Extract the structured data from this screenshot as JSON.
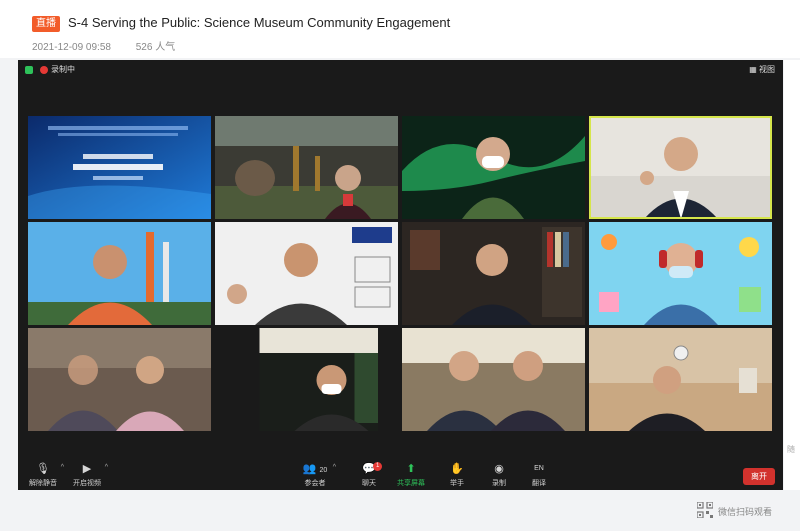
{
  "header": {
    "live_label": "直播",
    "title": "S-4 Serving the Public: Science Museum Community Engagement",
    "date": "2021-12-09 09:58",
    "views": "526 人气"
  },
  "meeting": {
    "recording_label": "录制中",
    "view_button": "视图",
    "participants_count": "20",
    "chat_badge": "1"
  },
  "toolbar": {
    "unmute": "解除静音",
    "start_video": "开启视频",
    "participants": "参会者",
    "chat": "聊天",
    "share_screen": "共享屏幕",
    "raise_hand": "举手",
    "record": "录制",
    "language": "翻译",
    "language_code": "EN",
    "leave": "离开"
  },
  "side_panel_label": "随",
  "scan_to_watch": "微信扫码观看",
  "colors": {
    "live_badge": "#f25c2a",
    "active_speaker": "#d6e64b",
    "leave_button": "#d2322d",
    "share_icon": "#2ec25a",
    "meeting_bg": "#1a1a1a"
  }
}
